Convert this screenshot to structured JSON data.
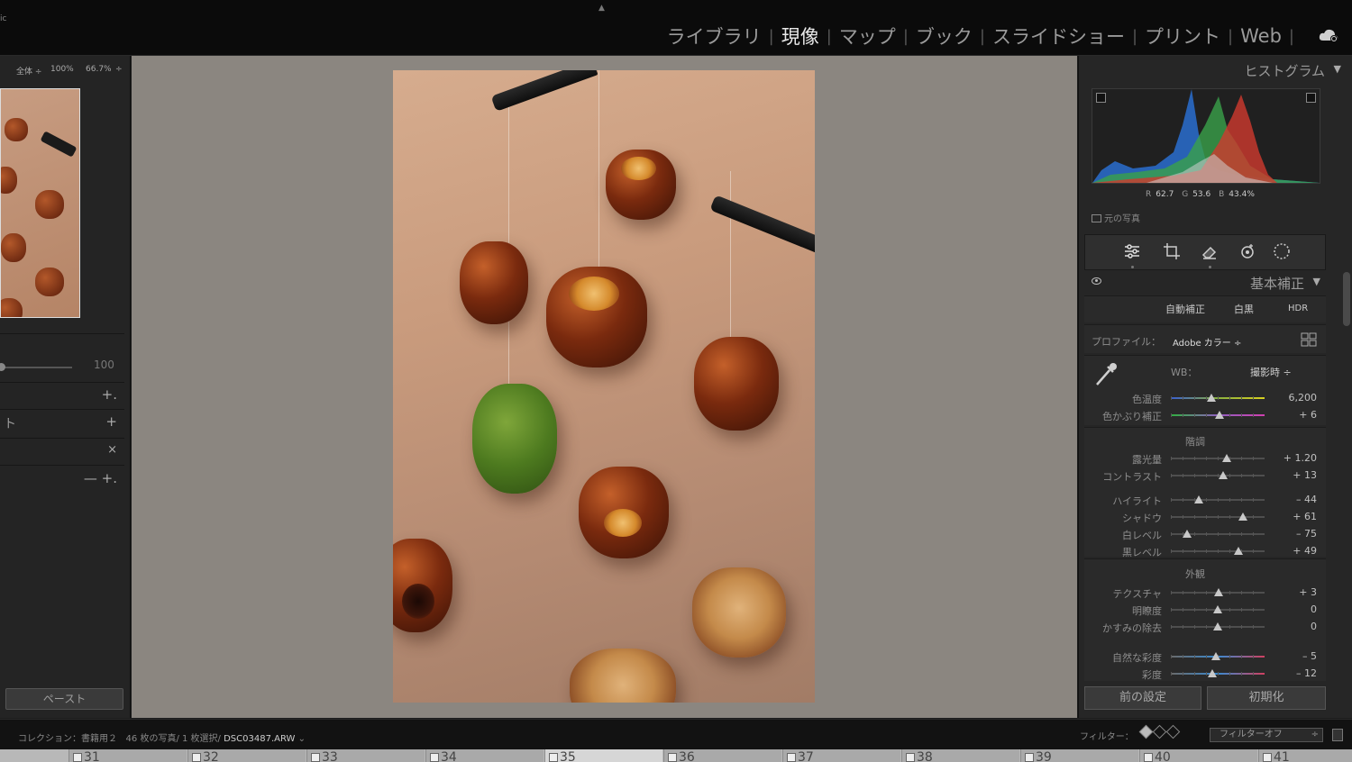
{
  "topbar": {
    "app_mark": "ic",
    "modules": [
      "ライブラリ",
      "現像",
      "マップ",
      "ブック",
      "スライドショー",
      "プリント",
      "Web"
    ],
    "active_module": "現像"
  },
  "left": {
    "nav_fit": "全体 ÷",
    "nav_100": "100%",
    "nav_667": "66.7%",
    "nav_arrow": "÷",
    "slider_value": "100",
    "sections": [
      {
        "label": "",
        "action": "+."
      },
      {
        "label": "ト",
        "action": "+"
      },
      {
        "label": "",
        "action": "×"
      },
      {
        "label": "",
        "action": "— +."
      }
    ],
    "paste_label": "ペースト"
  },
  "right": {
    "histogram_title": "ヒストグラム",
    "histogram_readout": {
      "r_label": "R",
      "r": "62.7",
      "g_label": "G",
      "g": "53.6",
      "b_label": "B",
      "b": "43.4%"
    },
    "original_label": "元の写真",
    "basic_title": "基本補正",
    "auto_label": "自動補正",
    "bw_label": "白黒",
    "hdr_label": "HDR",
    "profile_label": "プロファイル：",
    "profile_value": "Adobe カラー ÷",
    "wb_label": "WB：",
    "wb_value": "撮影時 ÷",
    "wb_sliders": [
      {
        "label": "色温度",
        "value": "6,200",
        "pos": 0.43
      },
      {
        "label": "色かぶり補正",
        "value": "+ 6",
        "pos": 0.52
      }
    ],
    "tone_caption": "階調",
    "tone_sliders": [
      {
        "label": "露光量",
        "value": "+ 1.20",
        "pos": 0.6
      },
      {
        "label": "コントラスト",
        "value": "+ 13",
        "pos": 0.56
      },
      {
        "label": "ハイライト",
        "value": "– 44",
        "pos": 0.3
      },
      {
        "label": "シャドウ",
        "value": "+ 61",
        "pos": 0.77
      },
      {
        "label": "白レベル",
        "value": "– 75",
        "pos": 0.17
      },
      {
        "label": "黒レベル",
        "value": "+ 49",
        "pos": 0.72
      }
    ],
    "presence_caption": "外観",
    "presence_sliders": [
      {
        "label": "テクスチャ",
        "value": "+ 3",
        "pos": 0.51
      },
      {
        "label": "明瞭度",
        "value": "0",
        "pos": 0.5
      },
      {
        "label": "かすみの除去",
        "value": "0",
        "pos": 0.5
      }
    ],
    "color_sliders": [
      {
        "label": "自然な彩度",
        "value": "– 5",
        "pos": 0.48
      },
      {
        "label": "彩度",
        "value": "– 12",
        "pos": 0.44
      }
    ],
    "prev_label": "前の設定",
    "reset_label": "初期化"
  },
  "status": {
    "collection": "コレクション：書籍用２",
    "count": "46 枚の写真/ 1 枚選択/",
    "filename": "DSC03487.ARW",
    "filename_arrow": "⌄",
    "filter_label": "フィルター：",
    "filter_value": "フィルターオフ",
    "filter_arrow": "÷"
  },
  "filmstrip": [
    "31",
    "32",
    "33",
    "34",
    "35",
    "36",
    "37",
    "38",
    "39",
    "40",
    "41"
  ],
  "filmstrip_selected": "35",
  "colors": {
    "panel_bg": "#262626",
    "workspace_bg": "#8b8680",
    "hist_red": "#d03a2e",
    "hist_green": "#3aa14a",
    "hist_blue": "#2a6fd0"
  }
}
